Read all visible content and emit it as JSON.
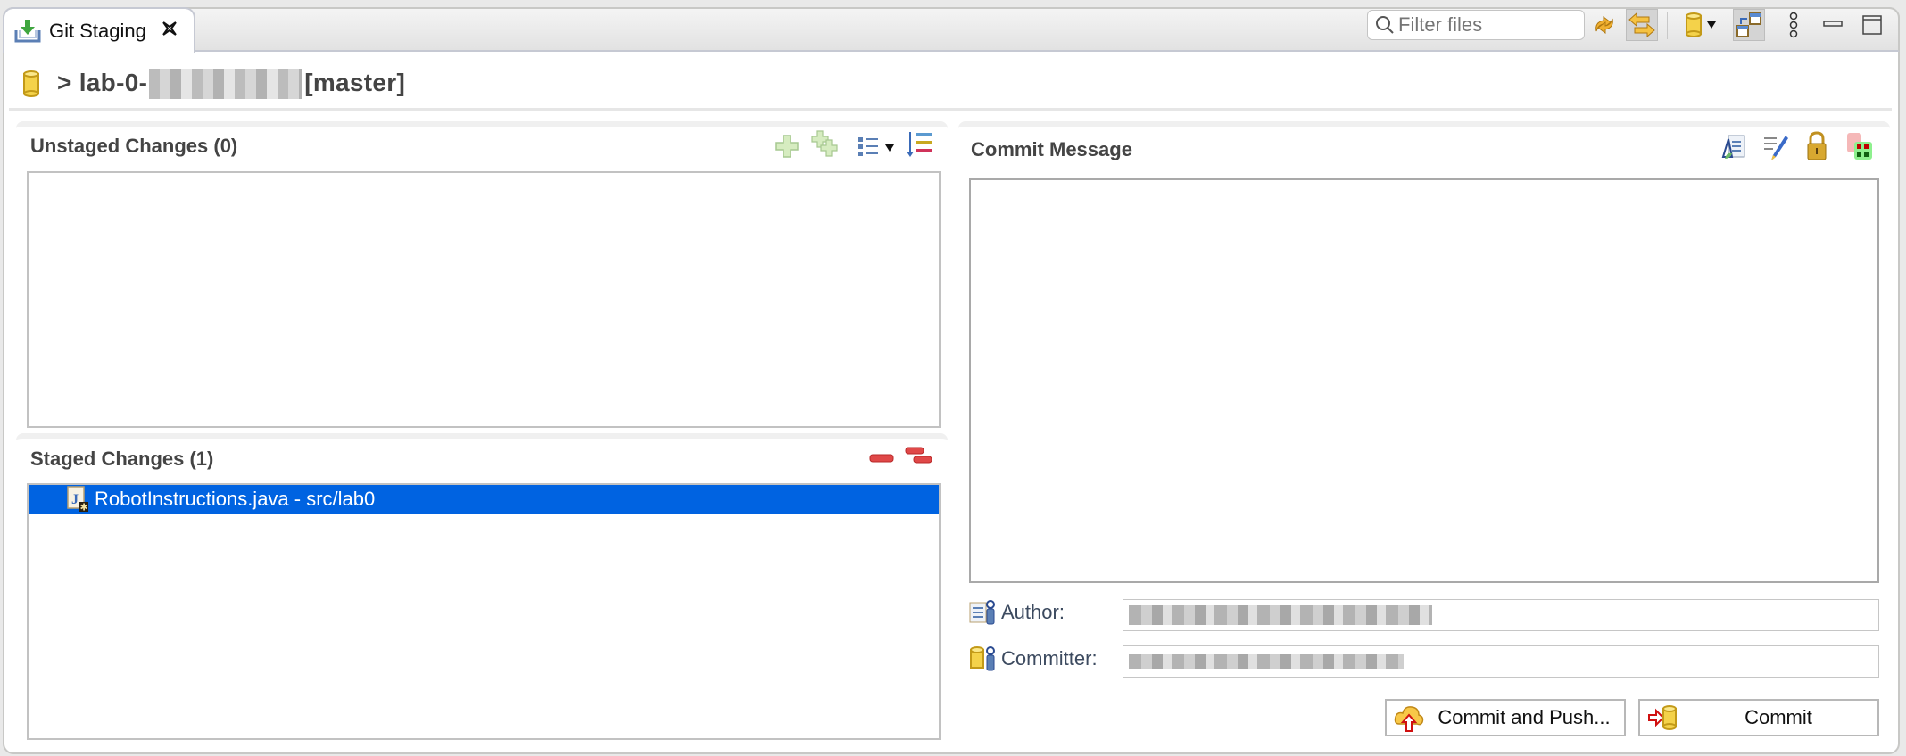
{
  "tab": {
    "title": "Git Staging",
    "icon": "git-staging-icon",
    "close_icon": "close-icon"
  },
  "toolbar": {
    "filter_placeholder": "Filter files",
    "buttons": [
      {
        "name": "refresh-button",
        "icon": "refresh-icon"
      },
      {
        "name": "compare-mode-button",
        "icon": "compare-arrows-icon",
        "pressed": true
      },
      {
        "name": "repository-select-button",
        "icon": "repository-icon"
      },
      {
        "name": "presentation-toggle-button",
        "icon": "layout-icon",
        "pressed": true
      },
      {
        "name": "view-menu-button",
        "icon": "kebab-menu-icon"
      },
      {
        "name": "minimize-button",
        "icon": "minimize-icon"
      },
      {
        "name": "maximize-button",
        "icon": "maximize-icon"
      }
    ]
  },
  "repo": {
    "prefix": "> lab-0-",
    "name_redacted": "",
    "branch": "[master]"
  },
  "unstaged": {
    "title": "Unstaged Changes (0)",
    "count": 0,
    "items": [],
    "actions": [
      "stage-selected",
      "stage-all",
      "presentation",
      "sort"
    ]
  },
  "staged": {
    "title": "Staged Changes (1)",
    "count": 1,
    "items": [
      {
        "label": "RobotInstructions.java - src/lab0",
        "file": "RobotInstructions.java",
        "path": "src/lab0",
        "selected": true
      }
    ],
    "actions": [
      "unstage-selected",
      "unstage-all"
    ]
  },
  "commit": {
    "title": "Commit Message",
    "message": "",
    "author_label": "Author:",
    "author_value": "",
    "committer_label": "Committer:",
    "committer_value": "",
    "commit_and_push_label": "Commit and Push...",
    "commit_label": "Commit"
  },
  "colors": {
    "selection": "#0063e1",
    "section_title": "#444444",
    "label_text": "#3c4a5f"
  }
}
